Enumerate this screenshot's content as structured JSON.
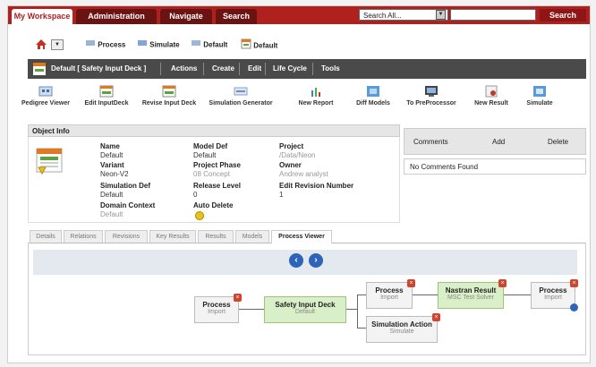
{
  "top_tabs": [
    {
      "label": "My Workspace"
    },
    {
      "label": "Administration"
    },
    {
      "label": "Navigate"
    },
    {
      "label": "Search"
    }
  ],
  "search": {
    "select_value": "Search All...",
    "button": "Search"
  },
  "bookmarks": [
    {
      "label": "Process"
    },
    {
      "label": "Simulate"
    },
    {
      "label": "Default"
    },
    {
      "label": "Default"
    }
  ],
  "dark_bar": {
    "title": "Default [ Safety Input Deck ]",
    "menus": [
      "Actions",
      "Create",
      "Edit",
      "Life Cycle",
      "Tools"
    ]
  },
  "toolbar": [
    "Pedigree Viewer",
    "Edit InputDeck",
    "Revise Input Deck",
    "Simulation Generator",
    "New Report",
    "Diff Models",
    "To PreProcessor",
    "New Result",
    "Simulate"
  ],
  "object_info": {
    "header": "Object Info",
    "fields": [
      {
        "label": "Name",
        "value": "Default"
      },
      {
        "label": "Variant",
        "value": "Neon-V2"
      },
      {
        "label": "Simulation Def",
        "value": "Default"
      },
      {
        "label": "Domain Context",
        "value": "Default"
      },
      {
        "label": "Model Def",
        "value": "Default"
      },
      {
        "label": "Project Phase",
        "value": "08 Concept"
      },
      {
        "label": "Release Level",
        "value": "0"
      },
      {
        "label": "Auto Delete",
        "value": ""
      },
      {
        "label": "Project",
        "value": "/Data/Neon"
      },
      {
        "label": "Owner",
        "value": "Andrew analyst"
      },
      {
        "label": "Edit Revision Number",
        "value": "1"
      }
    ]
  },
  "comments": {
    "headers": [
      "Comments",
      "Add",
      "Delete"
    ],
    "empty": "No Comments Found"
  },
  "tabs": [
    "Details",
    "Relations",
    "Revisions",
    "Key Results",
    "Results",
    "Models",
    "Process Viewer"
  ],
  "process": {
    "nodes": [
      {
        "title": "Process",
        "sub": "Import"
      },
      {
        "title": "Safety Input Deck",
        "sub": "Default"
      },
      {
        "title": "Process",
        "sub": "Import"
      },
      {
        "title": "Simulation Action",
        "sub": "Simulate"
      },
      {
        "title": "Nastran Result",
        "sub": "MSC Test Solver"
      },
      {
        "title": "Process",
        "sub": "Import"
      }
    ]
  },
  "colors": {
    "brand": "#b0201f",
    "dark_bar": "#4a4a4a",
    "node_green": "#d9efc7",
    "nav_blue": "#2e64b8"
  }
}
